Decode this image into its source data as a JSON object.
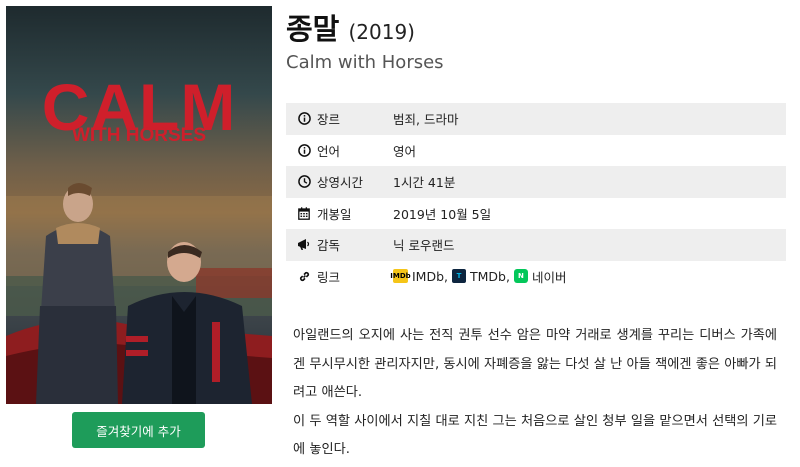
{
  "poster": {
    "title_line1": "CALM",
    "title_line2": "WITH HORSES"
  },
  "favorite_button": "즐겨찾기에 추가",
  "title": {
    "korean": "종말",
    "year": "(2019)",
    "english": "Calm with Horses"
  },
  "info": [
    {
      "key": "장르",
      "value": "범죄, 드라마",
      "icon": "info-icon"
    },
    {
      "key": "언어",
      "value": "영어",
      "icon": "info-icon"
    },
    {
      "key": "상영시간",
      "value": "1시간 41분",
      "icon": "clock-icon"
    },
    {
      "key": "개봉일",
      "value": "2019년 10월 5일",
      "icon": "calendar-icon"
    },
    {
      "key": "감독",
      "value": "닉 로우랜드",
      "icon": "megaphone-icon"
    },
    {
      "key": "링크",
      "icon": "link-icon"
    }
  ],
  "links": [
    {
      "label": "IMDb,",
      "icon": "imdb-icon"
    },
    {
      "label": "TMDb,",
      "icon": "tmdb-icon"
    },
    {
      "label": "네이버",
      "icon": "naver-icon"
    }
  ],
  "synopsis": {
    "p1": "아일랜드의 오지에 사는 전직 권투 선수 암은 마약 거래로 생계를 꾸리는 디버스 가족에겐 무시무시한 관리자지만, 동시에 자폐증을 앓는 다섯 살 난 아들 잭에겐 좋은 아빠가 되려고 애쓴다.",
    "p2": "이 두 역할 사이에서 지칠 대로 지친 그는 처음으로 살인 청부 일을 맡으면서 선택의 기로에 놓인다."
  },
  "colors": {
    "button": "#1e9c5a",
    "poster_title": "#cf1f2b",
    "row_stripe": "#eeeeee"
  }
}
